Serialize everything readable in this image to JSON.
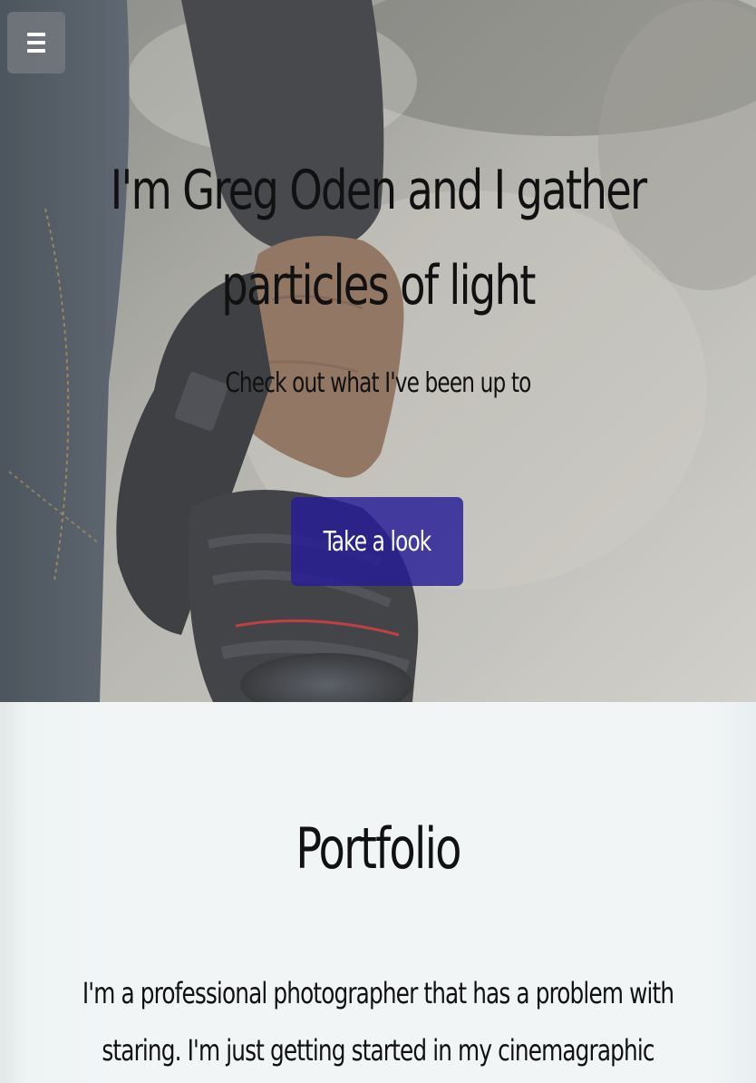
{
  "nav": {
    "menu_icon": "hamburger-menu-icon"
  },
  "hero": {
    "title": "I'm Greg Oden and I gather particles of light",
    "subtitle": "Check out what I've been up to",
    "cta_label": "Take a look",
    "cta_color": "#261c96"
  },
  "portfolio": {
    "title": "Portfolio",
    "description": "I'm a professional photographer that has a problem with staring. I'm just getting started in my cinemagraphic career. (videos soon)"
  }
}
